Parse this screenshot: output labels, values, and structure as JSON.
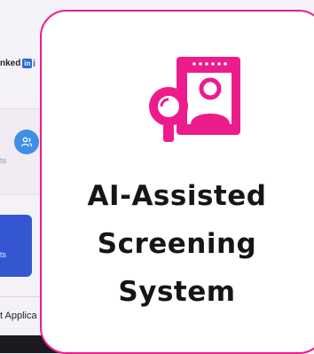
{
  "background": {
    "linkedin_text": "nked",
    "linkedin_badge": "in",
    "info_glyph": "i",
    "faint_text": "ts",
    "blue_card_text": "ts",
    "bottom_text": "t Applica",
    "icons": [
      "linkedin-icon",
      "users-icon"
    ]
  },
  "feature": {
    "title_lines": [
      "AI-Assisted",
      "Screening",
      "System"
    ],
    "icon": "candidate-profile-search-icon",
    "accent_color": "#ec1c8c"
  }
}
